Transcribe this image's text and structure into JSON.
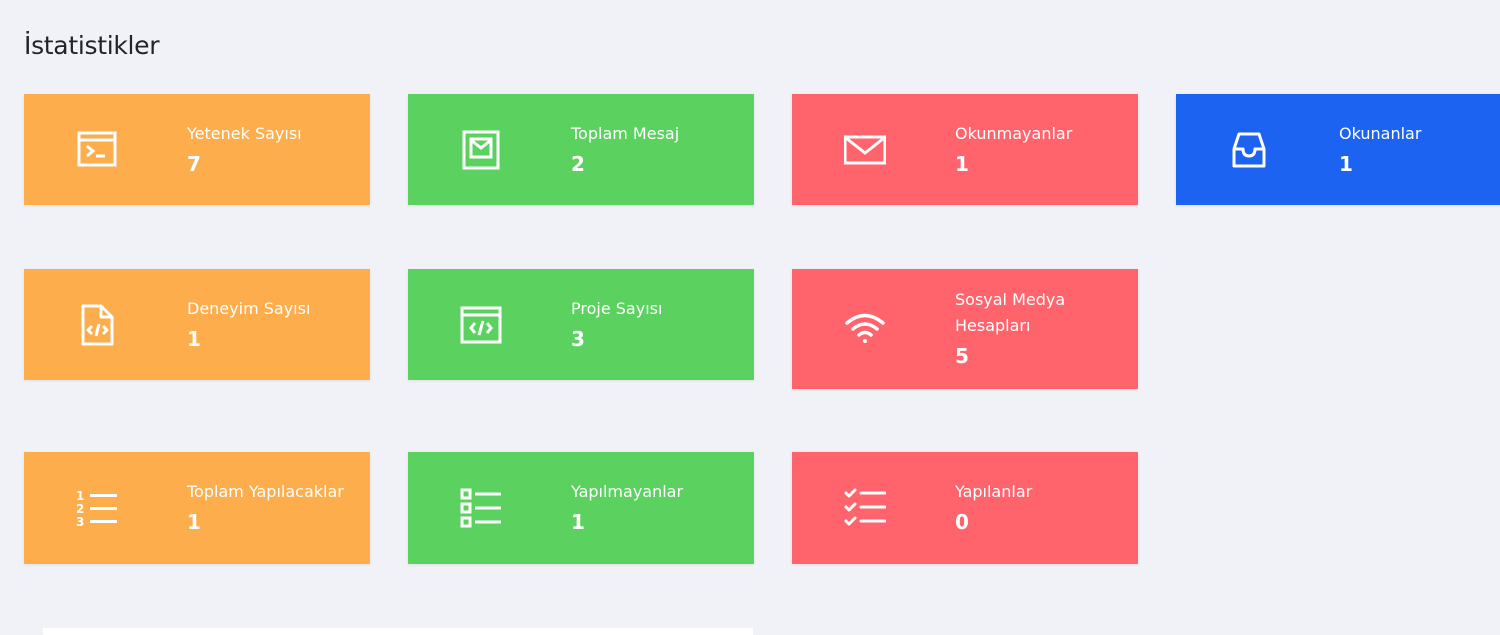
{
  "page": {
    "title": "İstatistikler"
  },
  "colors": {
    "orange": "#fdad4c",
    "green": "#5bd15f",
    "red": "#ff646c",
    "blue": "#1b63f0",
    "background": "#f1f2f7"
  },
  "cards": [
    {
      "label": "Yetenek Sayısı",
      "value": "7",
      "icon": "terminal-window-icon",
      "color": "orange"
    },
    {
      "label": "Toplam Mesaj",
      "value": "2",
      "icon": "mail-box-icon",
      "color": "green"
    },
    {
      "label": "Okunmayanlar",
      "value": "1",
      "icon": "envelope-icon",
      "color": "red"
    },
    {
      "label": "Okunanlar",
      "value": "1",
      "icon": "inbox-tray-icon",
      "color": "blue"
    },
    {
      "label": "Deneyim Sayısı",
      "value": "1",
      "icon": "code-file-icon",
      "color": "orange"
    },
    {
      "label": "Proje Sayısı",
      "value": "3",
      "icon": "code-window-icon",
      "color": "green"
    },
    {
      "label": "Sosyal Medya Hesapları",
      "value": "5",
      "icon": "wifi-icon",
      "color": "red"
    },
    {
      "label": "Toplam Yapılacaklar",
      "value": "1",
      "icon": "numbered-list-icon",
      "color": "orange"
    },
    {
      "label": "Yapılmayanlar",
      "value": "1",
      "icon": "checkbox-list-icon",
      "color": "green"
    },
    {
      "label": "Yapılanlar",
      "value": "0",
      "icon": "checklist-icon",
      "color": "red"
    }
  ]
}
